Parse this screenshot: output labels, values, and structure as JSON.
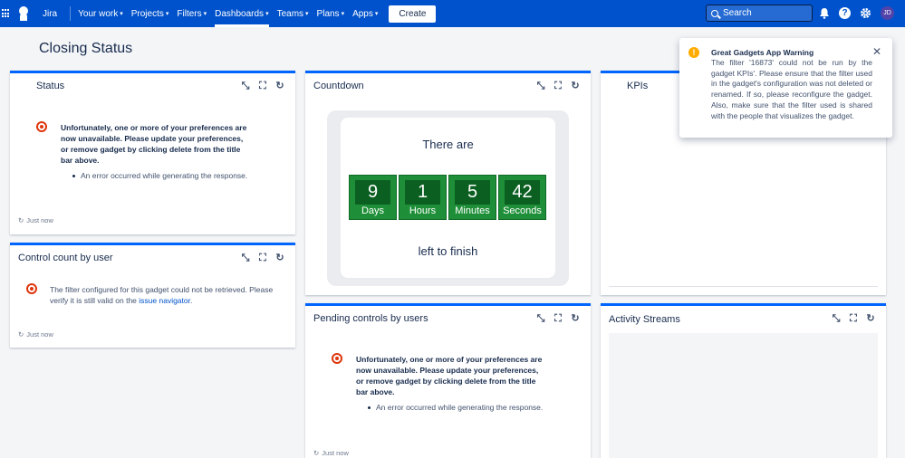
{
  "nav": {
    "brand": "Jira",
    "items": [
      {
        "label": "Your work"
      },
      {
        "label": "Projects"
      },
      {
        "label": "Filters"
      },
      {
        "label": "Dashboards"
      },
      {
        "label": "Teams"
      },
      {
        "label": "Plans"
      },
      {
        "label": "Apps"
      }
    ],
    "create_label": "Create",
    "search_placeholder": "Search",
    "avatar_initials": "JD"
  },
  "page": {
    "title": "Closing Status"
  },
  "gadgets": {
    "status": {
      "title": "Status",
      "error": "Unfortunately, one or more of your preferences are now unavailable. Please update your preferences, or remove gadget by clicking delete from the title bar above.",
      "bullet": "An error occurred while generating the response.",
      "footer": "Just now"
    },
    "countdown": {
      "title": "Countdown",
      "top_text": "There are",
      "bottom_text": "left to finish",
      "units": [
        {
          "value": "9",
          "label": "Days"
        },
        {
          "value": "1",
          "label": "Hours"
        },
        {
          "value": "5",
          "label": "Minutes"
        },
        {
          "value": "42",
          "label": "Seconds"
        }
      ]
    },
    "kpis": {
      "title": "KPIs"
    },
    "control_count": {
      "title": "Control count by user",
      "text_before": "The filter configured for this gadget could not be retrieved. Please verify it is still valid on the",
      "link": "issue navigator",
      "text_after": ".",
      "footer": "Just now"
    },
    "pending": {
      "title": "Pending controls by users",
      "error": "Unfortunately, one or more of your preferences are now unavailable. Please update your preferences, or remove gadget by clicking delete from the title bar above.",
      "bullet": "An error occurred while generating the response.",
      "footer": "Just now"
    },
    "activity": {
      "title": "Activity Streams"
    }
  },
  "notification": {
    "title": "Great Gadgets App Warning",
    "body": "The filter '16873' could not be run by the gadget KPIs'. Please ensure that the filter used in the gadget's configuration was not deleted or renamed. If so, please reconfigure the gadget. Also, make sure that the filter used is shared with the people that visualizes the gadget."
  },
  "colors": {
    "nav": "#0052cc",
    "accent": "#0065ff",
    "error": "#de350b",
    "countdown": "#1e8f38",
    "warning": "#ffab00"
  }
}
